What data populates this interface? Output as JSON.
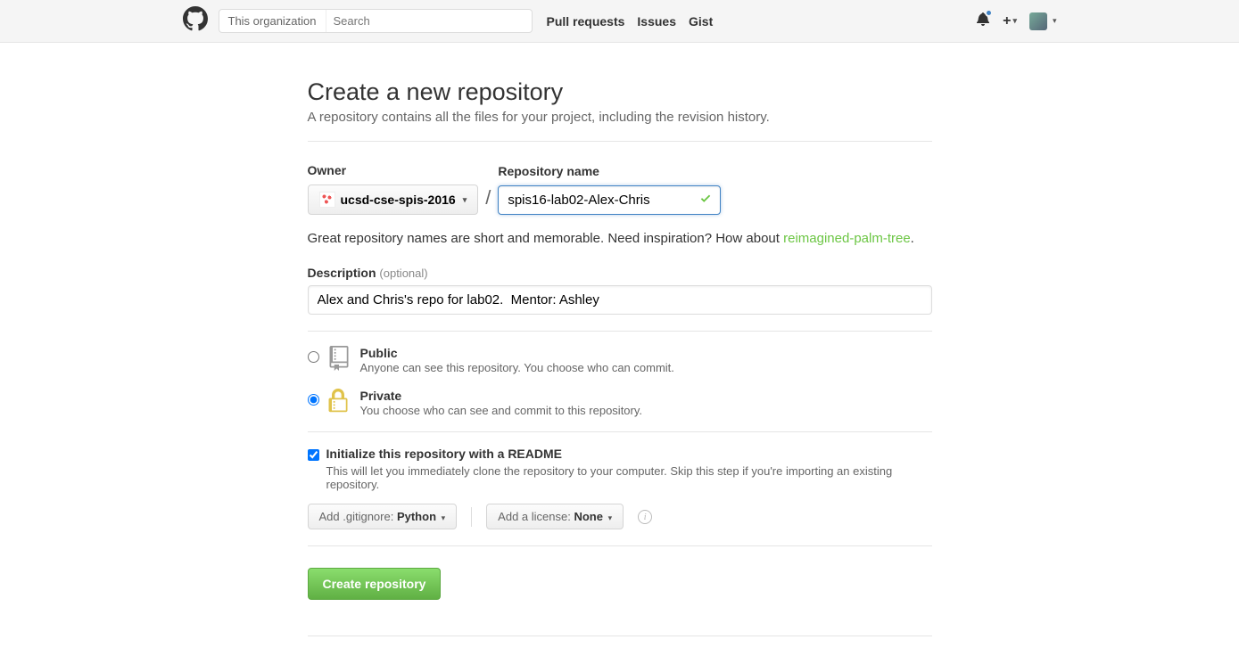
{
  "header": {
    "searchScope": "This organization",
    "searchPlaceholder": "Search",
    "nav": {
      "pull": "Pull requests",
      "issues": "Issues",
      "gist": "Gist"
    }
  },
  "page": {
    "title": "Create a new repository",
    "subtitle": "A repository contains all the files for your project, including the revision history."
  },
  "owner": {
    "label": "Owner",
    "value": "ucsd-cse-spis-2016"
  },
  "repo": {
    "label": "Repository name",
    "value": "spis16-lab02-Alex-Chris"
  },
  "hint": {
    "text1": "Great repository names are short and memorable. Need inspiration? How about ",
    "suggestion": "reimagined-palm-tree",
    "dot": "."
  },
  "description": {
    "label": "Description",
    "optional": "(optional)",
    "value": "Alex and Chris's repo for lab02.  Mentor: Ashley"
  },
  "visibility": {
    "public": {
      "title": "Public",
      "note": "Anyone can see this repository. You choose who can commit."
    },
    "private": {
      "title": "Private",
      "note": "You choose who can see and commit to this repository."
    }
  },
  "init": {
    "title": "Initialize this repository with a README",
    "note": "This will let you immediately clone the repository to your computer. Skip this step if you're importing an existing repository."
  },
  "gitignore": {
    "label": "Add .gitignore: ",
    "value": "Python"
  },
  "license": {
    "label": "Add a license: ",
    "value": "None"
  },
  "submit": "Create repository"
}
